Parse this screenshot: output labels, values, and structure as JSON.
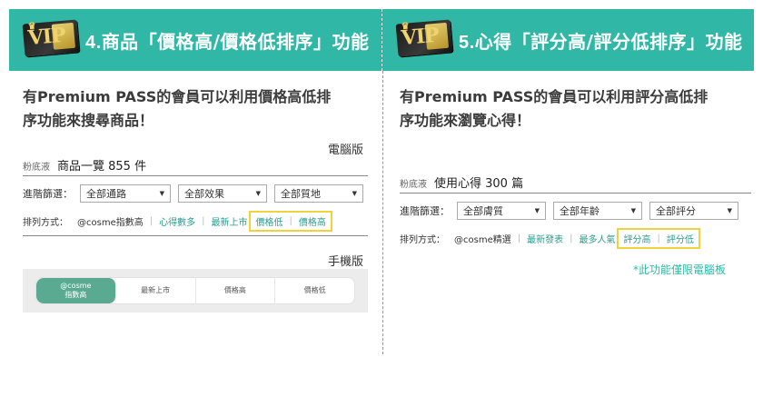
{
  "left": {
    "header": {
      "num": "4.",
      "pre": "商品",
      "highlight": "「價格高/價格低排序」",
      "post": "功能"
    },
    "intro_line1": "有Premium PASS的會員可以利用價格高低排",
    "intro_line2": "序功能來搜尋商品！",
    "desktop_label": "電腦版",
    "brand": "粉底液",
    "title": "商品一覽 855 件",
    "filter_label": "進階篩選：",
    "filters": [
      "全部通路",
      "全部效果",
      "全部質地"
    ],
    "sort_label": "排列方式：",
    "sort_items": [
      "@cosme指數高",
      "心得數多",
      "最新上市"
    ],
    "sort_highlight": [
      "價格低",
      "價格高"
    ],
    "mobile_label": "手機版",
    "mobile_tabs": {
      "active_line1": "@cosme",
      "active_line2": "指數高",
      "t2": "最新上市",
      "t3": "價格高",
      "t4": "價格低"
    }
  },
  "right": {
    "header": {
      "num": "5.",
      "pre": "心得",
      "highlight": "「評分高/評分低排序」",
      "post": "功能"
    },
    "intro_line1": "有Premium PASS的會員可以利用評分高低排",
    "intro_line2": "序功能來瀏覽心得！",
    "brand": "粉底液",
    "title": "使用心得 300 篇",
    "filter_label": "進階篩選：",
    "filters": [
      "全部膚質",
      "全部年齡",
      "全部評分"
    ],
    "sort_label": "排列方式：",
    "sort_items": [
      "@cosme精選",
      "最新發表",
      "最多人氣"
    ],
    "sort_highlight": [
      "評分高",
      "評分低"
    ],
    "note": "*此功能僅限電腦板"
  },
  "vip_text": "VIP",
  "colors": {
    "teal": "#30b7a5",
    "highlight": "#f0d33b",
    "mobile_active": "#5aaa92"
  }
}
